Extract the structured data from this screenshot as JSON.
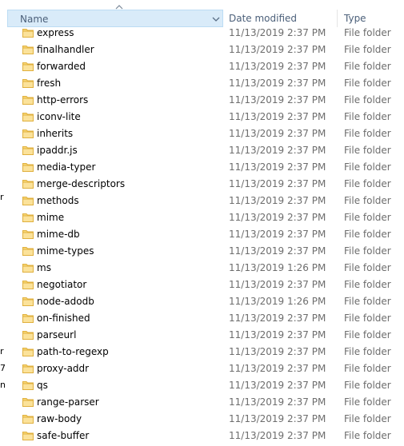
{
  "header": {
    "name_label": "Name",
    "date_label": "Date modified",
    "type_label": "Type"
  },
  "left_edge": [
    "r",
    "r",
    "7",
    "n"
  ],
  "files": [
    {
      "name": "express",
      "date": "11/13/2019 2:37 PM",
      "type": "File folder"
    },
    {
      "name": "finalhandler",
      "date": "11/13/2019 2:37 PM",
      "type": "File folder"
    },
    {
      "name": "forwarded",
      "date": "11/13/2019 2:37 PM",
      "type": "File folder"
    },
    {
      "name": "fresh",
      "date": "11/13/2019 2:37 PM",
      "type": "File folder"
    },
    {
      "name": "http-errors",
      "date": "11/13/2019 2:37 PM",
      "type": "File folder"
    },
    {
      "name": "iconv-lite",
      "date": "11/13/2019 2:37 PM",
      "type": "File folder"
    },
    {
      "name": "inherits",
      "date": "11/13/2019 2:37 PM",
      "type": "File folder"
    },
    {
      "name": "ipaddr.js",
      "date": "11/13/2019 2:37 PM",
      "type": "File folder"
    },
    {
      "name": "media-typer",
      "date": "11/13/2019 2:37 PM",
      "type": "File folder"
    },
    {
      "name": "merge-descriptors",
      "date": "11/13/2019 2:37 PM",
      "type": "File folder"
    },
    {
      "name": "methods",
      "date": "11/13/2019 2:37 PM",
      "type": "File folder"
    },
    {
      "name": "mime",
      "date": "11/13/2019 2:37 PM",
      "type": "File folder"
    },
    {
      "name": "mime-db",
      "date": "11/13/2019 2:37 PM",
      "type": "File folder"
    },
    {
      "name": "mime-types",
      "date": "11/13/2019 2:37 PM",
      "type": "File folder"
    },
    {
      "name": "ms",
      "date": "11/13/2019 1:26 PM",
      "type": "File folder"
    },
    {
      "name": "negotiator",
      "date": "11/13/2019 2:37 PM",
      "type": "File folder"
    },
    {
      "name": "node-adodb",
      "date": "11/13/2019 1:26 PM",
      "type": "File folder"
    },
    {
      "name": "on-finished",
      "date": "11/13/2019 2:37 PM",
      "type": "File folder"
    },
    {
      "name": "parseurl",
      "date": "11/13/2019 2:37 PM",
      "type": "File folder"
    },
    {
      "name": "path-to-regexp",
      "date": "11/13/2019 2:37 PM",
      "type": "File folder"
    },
    {
      "name": "proxy-addr",
      "date": "11/13/2019 2:37 PM",
      "type": "File folder"
    },
    {
      "name": "qs",
      "date": "11/13/2019 2:37 PM",
      "type": "File folder"
    },
    {
      "name": "range-parser",
      "date": "11/13/2019 2:37 PM",
      "type": "File folder"
    },
    {
      "name": "raw-body",
      "date": "11/13/2019 2:37 PM",
      "type": "File folder"
    },
    {
      "name": "safe-buffer",
      "date": "11/13/2019 2:37 PM",
      "type": "File folder"
    }
  ]
}
